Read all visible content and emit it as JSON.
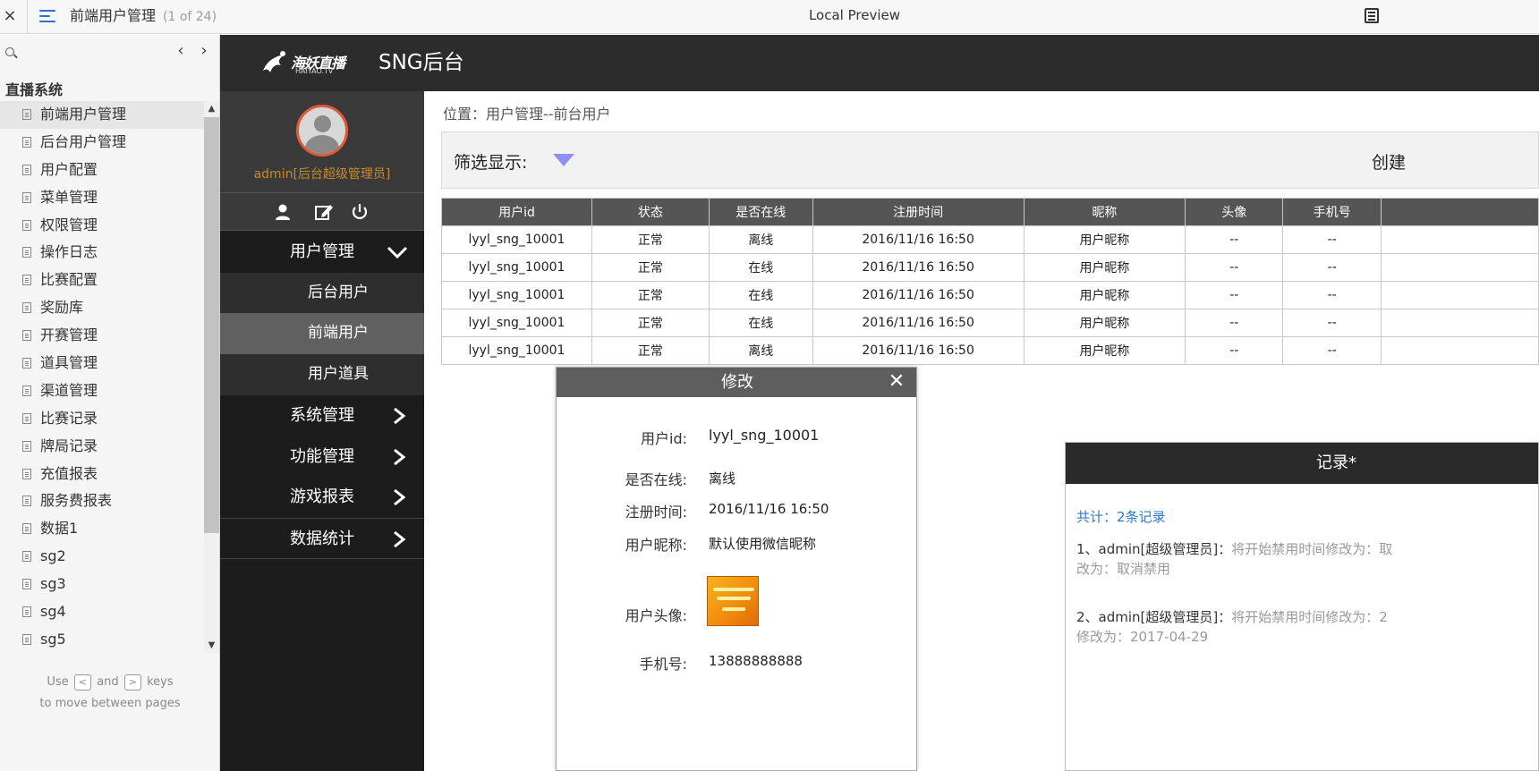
{
  "toolbar": {
    "close_label": "×",
    "doc_title": "前端用户管理",
    "page_count": "(1 of 24)",
    "center_title": "Local Preview"
  },
  "pages_sidebar": {
    "search_placeholder": "",
    "section_title": "直播系统",
    "items": [
      {
        "label": "前端用户管理"
      },
      {
        "label": "后台用户管理"
      },
      {
        "label": "用户配置"
      },
      {
        "label": "菜单管理"
      },
      {
        "label": "权限管理"
      },
      {
        "label": "操作日志"
      },
      {
        "label": "比赛配置"
      },
      {
        "label": "奖励库"
      },
      {
        "label": "开赛管理"
      },
      {
        "label": "道具管理"
      },
      {
        "label": "渠道管理"
      },
      {
        "label": "比赛记录"
      },
      {
        "label": "牌局记录"
      },
      {
        "label": "充值报表"
      },
      {
        "label": "服务费报表"
      },
      {
        "label": "数据1"
      },
      {
        "label": "sg2"
      },
      {
        "label": "sg3"
      },
      {
        "label": "sg4"
      },
      {
        "label": "sg5"
      }
    ],
    "hint_use": "Use",
    "hint_key1": "<",
    "hint_and": "and",
    "hint_key2": ">",
    "hint_keys": "keys",
    "hint_line2": "to move between pages"
  },
  "app": {
    "logo_text": "海妖直播",
    "logo_sub": "HAIYAO.TV",
    "title": "SNG后台",
    "admin_name": "admin[后台超级管理员]",
    "menu": [
      {
        "label": "用户管理",
        "type": "parent",
        "expanded": true
      },
      {
        "label": "后台用户",
        "type": "sub"
      },
      {
        "label": "前端用户",
        "type": "sub",
        "active": true
      },
      {
        "label": "用户道具",
        "type": "sub"
      },
      {
        "label": "系统管理",
        "type": "parent"
      },
      {
        "label": "功能管理",
        "type": "parent"
      },
      {
        "label": "游戏报表",
        "type": "parent"
      },
      {
        "label": "数据统计",
        "type": "parent"
      }
    ]
  },
  "main": {
    "location": "位置：用户管理--前台用户",
    "filter_label": "筛选显示:",
    "create_label": "创建",
    "table": {
      "headers": [
        "用户id",
        "状态",
        "是否在线",
        "注册时间",
        "昵称",
        "头像",
        "手机号",
        ""
      ],
      "rows": [
        [
          "lyyl_sng_10001",
          "正常",
          "离线",
          "2016/11/16 16:50",
          "用户昵称",
          "--",
          "--",
          ""
        ],
        [
          "lyyl_sng_10001",
          "正常",
          "在线",
          "2016/11/16 16:50",
          "用户昵称",
          "--",
          "--",
          ""
        ],
        [
          "lyyl_sng_10001",
          "正常",
          "在线",
          "2016/11/16 16:50",
          "用户昵称",
          "--",
          "--",
          ""
        ],
        [
          "lyyl_sng_10001",
          "正常",
          "在线",
          "2016/11/16 16:50",
          "用户昵称",
          "--",
          "--",
          ""
        ],
        [
          "lyyl_sng_10001",
          "正常",
          "离线",
          "2016/11/16 16:50",
          "用户昵称",
          "--",
          "--",
          ""
        ]
      ]
    }
  },
  "edit_dialog": {
    "title": "修改",
    "close_label": "✕",
    "fields": {
      "user_id_label": "用户id:",
      "user_id_value": "lyyl_sng_10001",
      "online_label": "是否在线:",
      "online_value": "离线",
      "reg_label": "注册时间:",
      "reg_value": "2016/11/16 16:50",
      "nick_label": "用户昵称:",
      "nick_value": "默认使用微信昵称",
      "avatar_label": "用户头像:",
      "phone_label": "手机号:",
      "phone_value": "13888888888"
    }
  },
  "record_panel": {
    "title": "记录*",
    "count": "共计：2条记录",
    "records": [
      {
        "prefix": "1、admin[超级管理员]：",
        "text": "将开始禁用时间修改为：取",
        "text2": "改为：取消禁用"
      },
      {
        "prefix": "2、admin[超级管理员]：",
        "text": "将开始禁用时间修改为：2",
        "text2": "修改为：2017-04-29"
      }
    ]
  },
  "colors": {
    "header_bg": "#2c2c2c",
    "nav_bg": "#1c1c1c",
    "active_sub": "#606060",
    "admin_name": "#c98a2a",
    "link_blue": "#2d78d6",
    "filter_caret": "#8f8ff0"
  }
}
